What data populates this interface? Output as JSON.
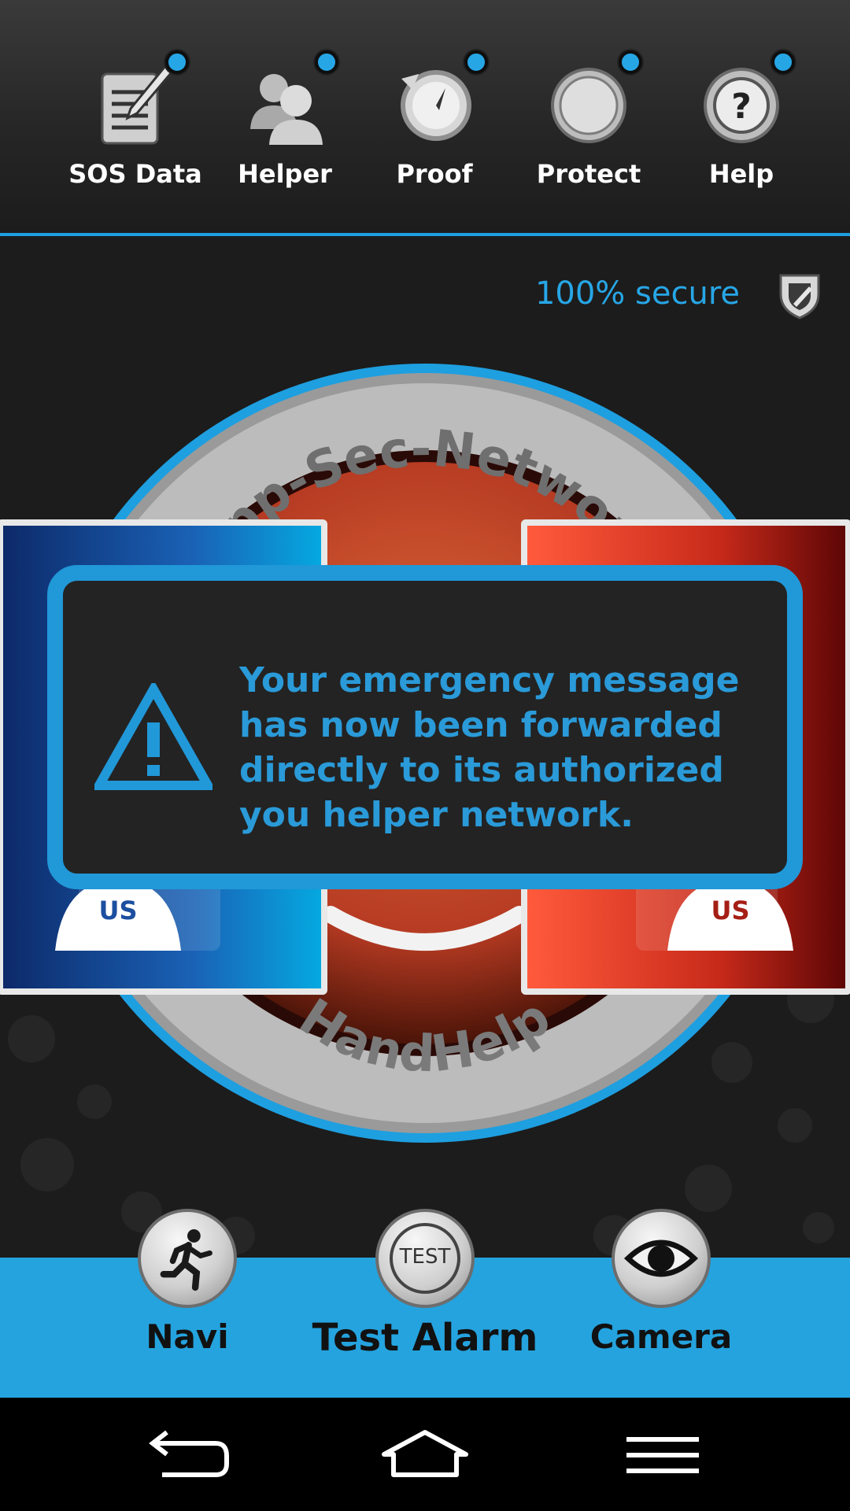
{
  "topbar": {
    "items": [
      {
        "label": "SOS Data",
        "icon": "clipboard-pencil-icon"
      },
      {
        "label": "Helper",
        "icon": "people-icon"
      },
      {
        "label": "Proof",
        "icon": "history-clock-icon"
      },
      {
        "label": "Protect",
        "icon": "round-button-icon"
      },
      {
        "label": "Help",
        "icon": "question-icon"
      }
    ]
  },
  "status": {
    "secure_text": "100% secure"
  },
  "emblem": {
    "top_text": "App-Sec-Network",
    "bottom_text": "HandHelp"
  },
  "panels": {
    "left_tag": "US",
    "right_tag": "US"
  },
  "dialog": {
    "message": "Your emergency message has now been forwarded directly to its authorized you helper network."
  },
  "bottombar": {
    "navi_label": "Navi",
    "test_label": "Test Alarm",
    "test_button_text": "TEST",
    "camera_label": "Camera"
  },
  "colors": {
    "accent": "#27a6e6",
    "dialog_border": "#2198d8",
    "bottom_bar": "#25a3de"
  }
}
